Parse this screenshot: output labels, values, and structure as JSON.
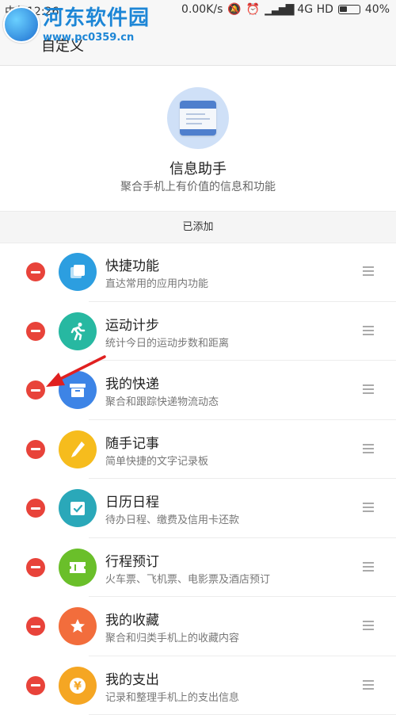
{
  "status_bar": {
    "time": "中午12:26",
    "speed": "0.00K/s",
    "network": "4G HD",
    "battery": "40%",
    "battery_level": 0.4
  },
  "titlebar": {
    "title": "自定义",
    "watermark_name": "河东软件园",
    "watermark_url": "www.pc0359.cn"
  },
  "header": {
    "title": "信息助手",
    "subtitle": "聚合手机上有价值的信息和功能"
  },
  "section": {
    "label": "已添加"
  },
  "items": [
    {
      "name": "快捷功能",
      "desc": "直达常用的应用内功能",
      "icon": "stack-icon",
      "color": "#2c9ee0"
    },
    {
      "name": "运动计步",
      "desc": "统计今日的运动步数和距离",
      "icon": "running-icon",
      "color": "#27b8a1"
    },
    {
      "name": "我的快递",
      "desc": "聚合和跟踪快递物流动态",
      "icon": "box-icon",
      "color": "#3d84e6"
    },
    {
      "name": "随手记事",
      "desc": "简单快捷的文字记录板",
      "icon": "pen-icon",
      "color": "#f6bc1d"
    },
    {
      "name": "日历日程",
      "desc": "待办日程、缴费及信用卡还款",
      "icon": "calendar-check-icon",
      "color": "#2aa8b9"
    },
    {
      "name": "行程预订",
      "desc": "火车票、飞机票、电影票及酒店预订",
      "icon": "ticket-icon",
      "color": "#6abf2a"
    },
    {
      "name": "我的收藏",
      "desc": "聚合和归类手机上的收藏内容",
      "icon": "star-icon",
      "color": "#f26d3c"
    },
    {
      "name": "我的支出",
      "desc": "记录和整理手机上的支出信息",
      "icon": "yen-icon",
      "color": "#f5a623"
    }
  ]
}
